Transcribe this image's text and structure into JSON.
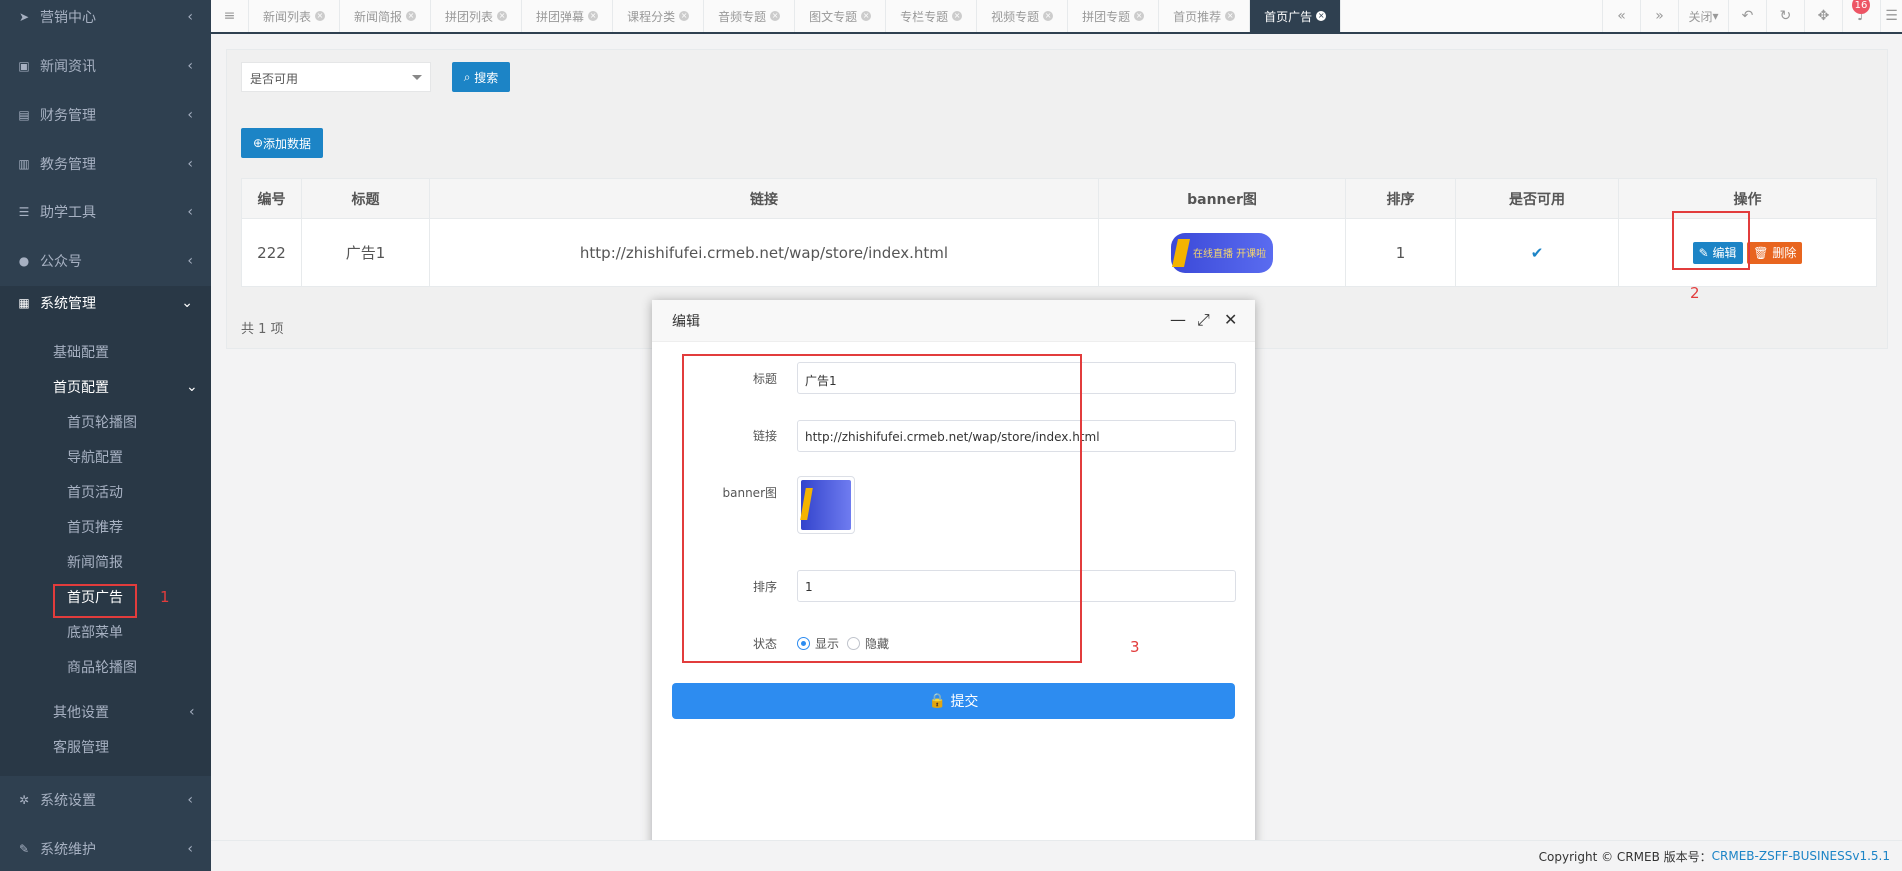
{
  "sidebar": {
    "items": [
      {
        "icon": "paper-plane-icon",
        "label": "营销中心"
      },
      {
        "icon": "image-icon",
        "label": "新闻资讯"
      },
      {
        "icon": "money-icon",
        "label": "财务管理"
      },
      {
        "icon": "book-icon",
        "label": "教务管理"
      },
      {
        "icon": "list-icon",
        "label": "助学工具"
      },
      {
        "icon": "wechat-icon",
        "label": "公众号"
      },
      {
        "icon": "grid-icon",
        "label": "系统管理"
      }
    ],
    "sub": {
      "basic": "基础配置",
      "home_config": "首页配置",
      "home_children": [
        "首页轮播图",
        "导航配置",
        "首页活动",
        "首页推荐",
        "新闻简报",
        "首页广告",
        "底部菜单",
        "商品轮播图"
      ],
      "other": "其他设置",
      "service": "客服管理"
    },
    "bottom": [
      {
        "icon": "gear-icon",
        "label": "系统设置"
      },
      {
        "icon": "wrench-icon",
        "label": "系统维护"
      }
    ]
  },
  "tabs": [
    "新闻列表",
    "新闻简报",
    "拼团列表",
    "拼团弹幕",
    "课程分类",
    "音频专题",
    "图文专题",
    "专栏专题",
    "视频专题",
    "拼团专题",
    "首页推荐",
    "首页广告"
  ],
  "toolbar": {
    "close_label": "关闭",
    "notification_count": "16"
  },
  "filter": {
    "select_value": "是否可用",
    "search_label": "搜索",
    "add_label": "添加数据"
  },
  "table": {
    "headers": [
      "编号",
      "标题",
      "链接",
      "banner图",
      "排序",
      "是否可用",
      "操作"
    ],
    "row": {
      "id": "222",
      "title": "广告1",
      "link": "http://zhishifufei.crmeb.net/wap/store/index.html",
      "sort": "1"
    },
    "edit_label": "编辑",
    "delete_label": "删除",
    "total": "共 1 项"
  },
  "banner_text": "在线直播 开课啦",
  "annotations": {
    "a1": "1",
    "a2": "2",
    "a3": "3"
  },
  "modal": {
    "title": "编辑",
    "labels": {
      "title": "标题",
      "link": "链接",
      "banner": "banner图",
      "sort": "排序",
      "status": "状态"
    },
    "values": {
      "title": "广告1",
      "link": "http://zhishifufei.crmeb.net/wap/store/index.html",
      "sort": "1"
    },
    "status_show": "显示",
    "status_hide": "隐藏",
    "submit_label": "提交"
  },
  "footer": {
    "copyright": "Copyright © CRMEB 版本号：",
    "version": "CRMEB-ZSFF-BUSINESSv1.5.1"
  },
  "colors": {
    "sidebar": "#2f4050",
    "primary": "#1c84c6",
    "submit": "#2d8cf0",
    "annotation": "#e23c3c"
  }
}
